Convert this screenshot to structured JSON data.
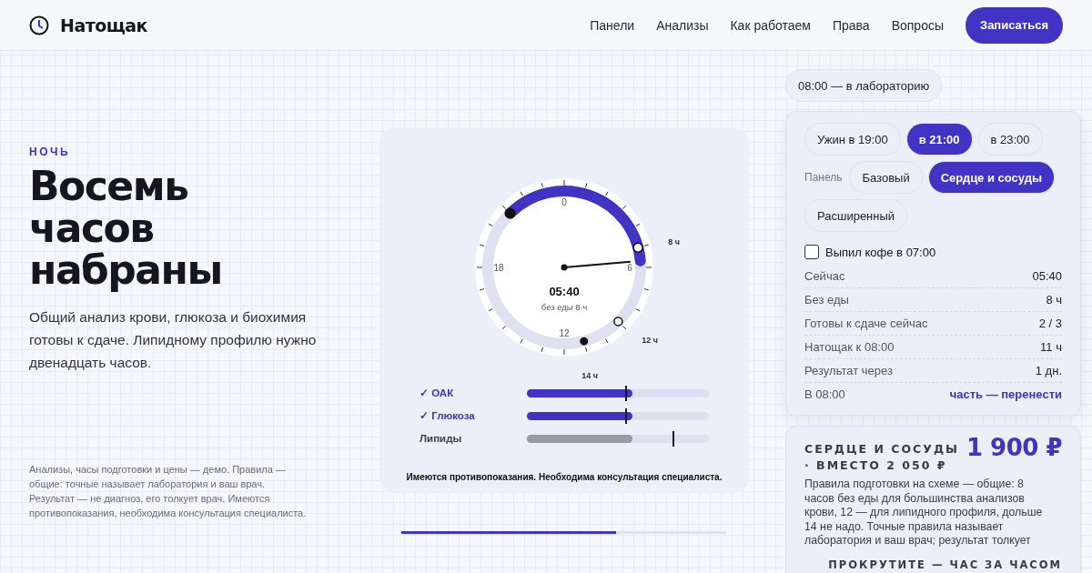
{
  "header": {
    "brand": "Натощак",
    "nav": [
      "Панели",
      "Анализы",
      "Как работаем",
      "Права",
      "Вопросы"
    ],
    "cta": "Записаться"
  },
  "hero": {
    "eyebrow": "НОЧЬ",
    "title": "Восемь часов набраны",
    "lead": "Общий анализ крови, глюкоза и биохимия готовы к сдаче. Липидному профилю нужно двенадцать часов.",
    "disclaimer": "Анализы, часы подготовки и цены — демо. Правила — общие: точные называет лаборатория и ваш врач. Результат — не диагноз, его толкует врач. Имеются противопоказания, необходима консультация специалиста."
  },
  "clock": {
    "hour_labels": [
      "0",
      "6",
      "12",
      "18"
    ],
    "marks": [
      "8 ч",
      "12 ч",
      "14 ч"
    ],
    "time": "05:40",
    "subtitle": "без еды 8 ч",
    "tests": [
      {
        "name": "✓ ОАК",
        "ready": true,
        "level": 0.58
      },
      {
        "name": "✓ Глюкоза",
        "ready": true,
        "level": 0.58
      },
      {
        "name": "Липиды",
        "ready": false,
        "level": 0.58
      }
    ],
    "warning": "Имеются противопоказания. Необходима консультация специалиста.",
    "progress": {
      "level": 0.66
    }
  },
  "planner": {
    "lab_chip": "08:00 — в лабораторию",
    "dinner": [
      {
        "label": "Ужин в 19:00",
        "selected": false
      },
      {
        "label": "в 21:00",
        "selected": true
      },
      {
        "label": "в 23:00",
        "selected": false
      }
    ],
    "panel_label": "Панель",
    "panels": [
      {
        "label": "Базовый",
        "selected": false
      },
      {
        "label": "Сердце и сосуды",
        "selected": true
      },
      {
        "label": "Расширенный",
        "selected": false
      }
    ],
    "coffee": {
      "label": "Выпил кофе в 07:00",
      "checked": false
    },
    "stats": [
      {
        "label": "Сейчас",
        "value": "05:40",
        "kind": "plain"
      },
      {
        "label": "Без еды",
        "value": "8 ч",
        "kind": "plain"
      },
      {
        "label": "Готовы к сдаче сейчас",
        "value": "2 / 3",
        "kind": "plain"
      },
      {
        "label": "Натощак к 08:00",
        "value": "11 ч",
        "kind": "plain"
      },
      {
        "label": "Результат через",
        "value": "1 дн.",
        "kind": "plain"
      },
      {
        "label": "В 08:00",
        "value": "часть — перенести",
        "kind": "link"
      }
    ]
  },
  "price": {
    "title": "СЕРДЦЕ И СОСУДЫ · ВМЕСТО 2 050 ₽",
    "amount": "1 900 ₽",
    "text": "Правила подготовки на схеме — общие: 8 часов без еды для большинства анализов крови, 12 — для липидного профиля, дольше 14 не надо. Точные правила называет лаборатория и ваш врач; результат толкует"
  },
  "scroll_hint": "ПРОКРУТИТЕ — ЧАС ЗА ЧАСОМ"
}
